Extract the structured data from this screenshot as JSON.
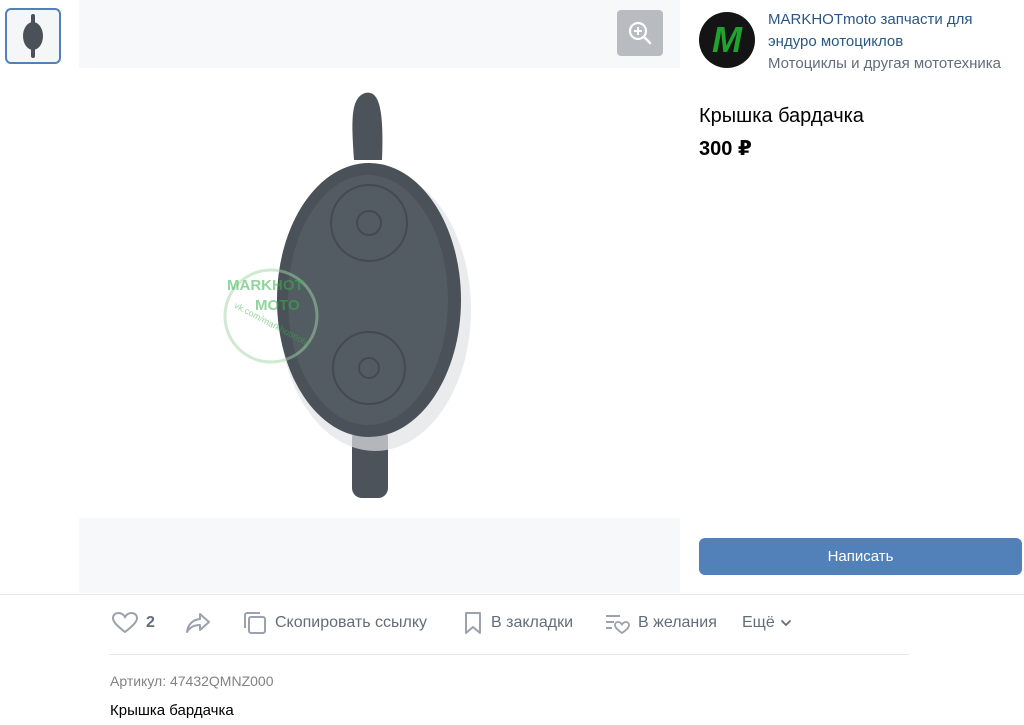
{
  "shop": {
    "name": "MARKHOTmoto запчасти для эндуро мотоциклов",
    "category": "Мотоциклы и другая мототехника",
    "avatar_letter": "M",
    "brand_color": "#1fa32e"
  },
  "product": {
    "title": "Крышка бардачка",
    "price": "300 ₽",
    "sku": "Артикул: 47432QMNZ000",
    "description": "Крышка бардачка"
  },
  "photo": {
    "watermark_line1": "MARKHOT",
    "watermark_line2": "MOTO",
    "watermark_url": "vk.com/markhotmoto"
  },
  "buttons": {
    "write": "Написать"
  },
  "actions": {
    "like_count": "2",
    "copy_link": "Скопировать ссылку",
    "bookmarks": "В закладки",
    "wishlist": "В желания",
    "more": "Ещё"
  },
  "icons": {
    "zoom": "zoom-in-icon",
    "like": "heart-icon",
    "share": "share-arrow-icon",
    "copy": "copy-icon",
    "bookmark": "bookmark-icon",
    "wishlist": "wishlist-icon",
    "more": "chevron-down-icon"
  },
  "colors": {
    "accent": "#5181b8",
    "link": "#2a5885",
    "muted": "#626d7a"
  }
}
